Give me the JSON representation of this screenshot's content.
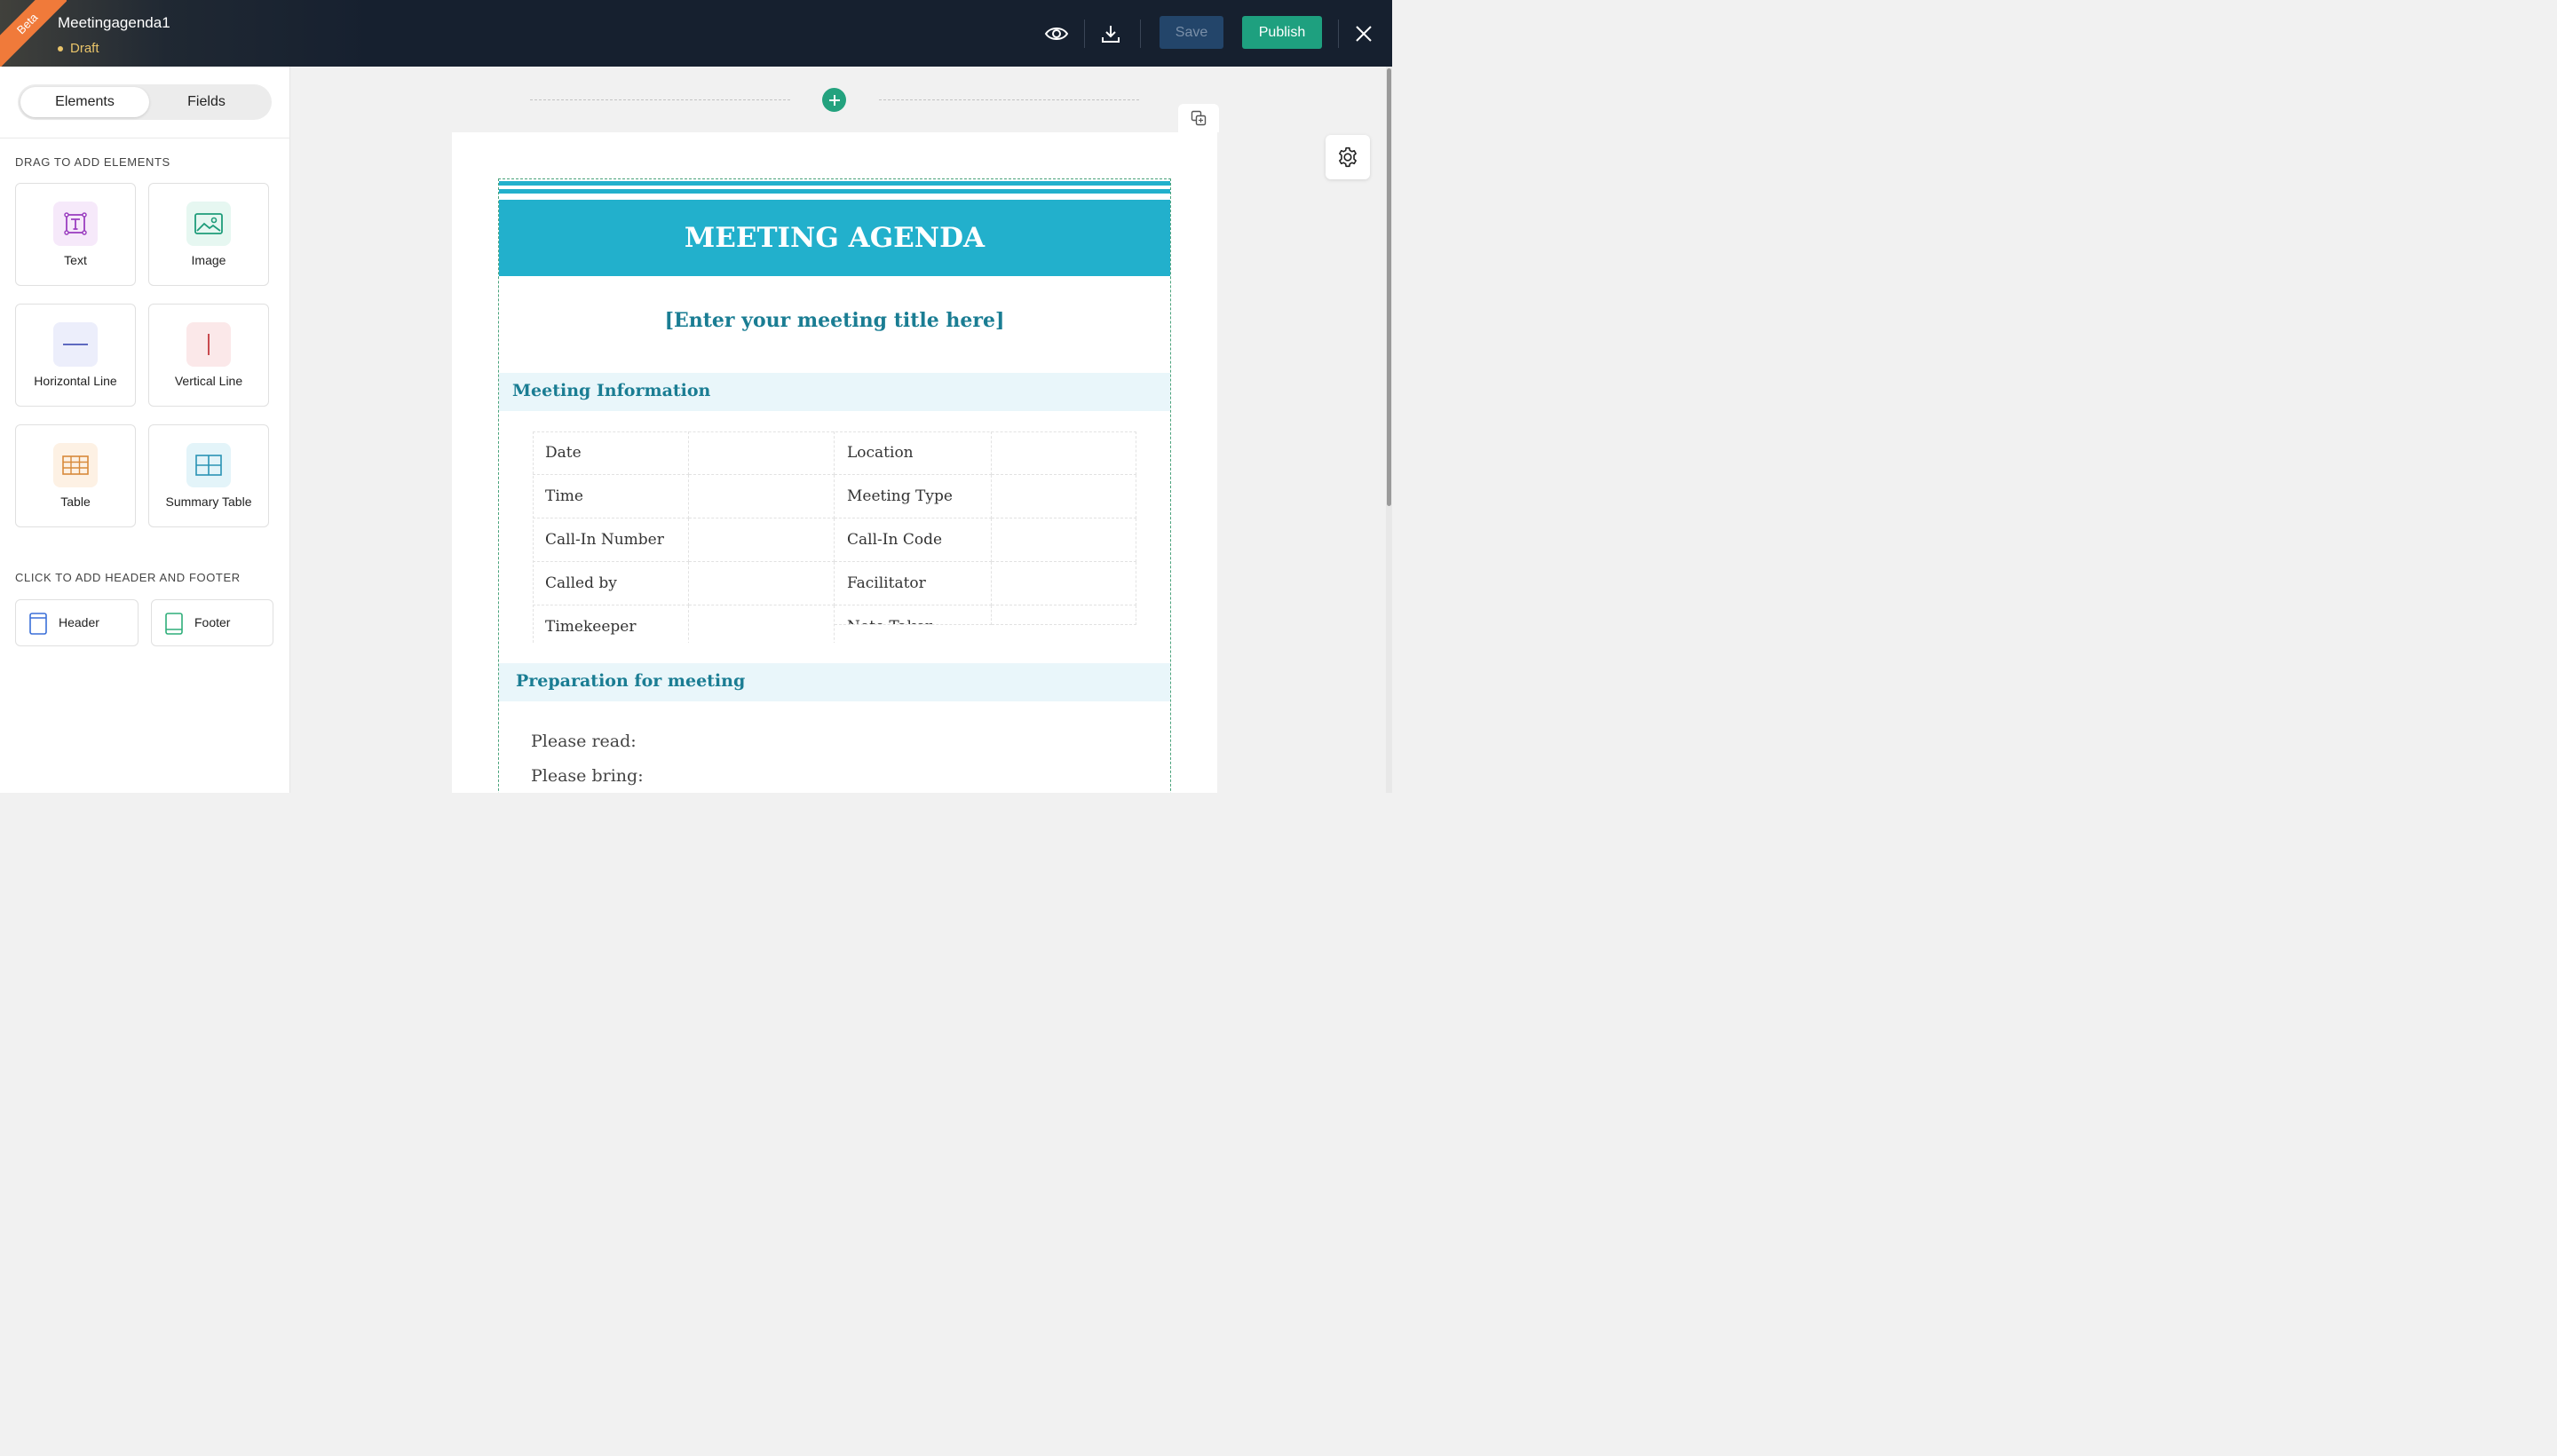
{
  "topbar": {
    "beta_label": "Beta",
    "document_name": "Meetingagenda1",
    "status": "Draft",
    "save_label": "Save",
    "publish_label": "Publish",
    "icons": [
      "eye-icon",
      "download-icon",
      "close-icon"
    ]
  },
  "sidebar": {
    "tabs": [
      {
        "label": "Elements",
        "active": true
      },
      {
        "label": "Fields",
        "active": false
      }
    ],
    "drag_heading": "DRAG TO ADD ELEMENTS",
    "elements": [
      {
        "label": "Text",
        "icon": "text-icon",
        "color": "#9b3fc0"
      },
      {
        "label": "Image",
        "icon": "image-icon",
        "color": "#1e9c7a"
      },
      {
        "label": "Horizontal Line",
        "icon": "horizontal-line-icon",
        "color": "#4a56b8"
      },
      {
        "label": "Vertical Line",
        "icon": "vertical-line-icon",
        "color": "#c4383e"
      },
      {
        "label": "Table",
        "icon": "table-icon",
        "color": "#d88a3a"
      },
      {
        "label": "Summary Table",
        "icon": "summary-table-icon",
        "color": "#2a93b4"
      }
    ],
    "header_footer_heading": "CLICK TO ADD HEADER AND FOOTER",
    "header_footer": [
      {
        "label": "Header",
        "icon": "header-icon",
        "color": "#3a6fd8"
      },
      {
        "label": "Footer",
        "icon": "footer-icon",
        "color": "#2fae7a"
      }
    ]
  },
  "document": {
    "banner_title": "MEETING AGENDA",
    "meeting_title_placeholder": "[Enter your meeting title here]",
    "section_info": "Meeting Information",
    "info_rows": [
      [
        "Date",
        "Location"
      ],
      [
        "Time",
        "Meeting Type"
      ],
      [
        "Call-In Number",
        "Call-In Code"
      ],
      [
        "Called by",
        "Facilitator"
      ],
      [
        "Timekeeper",
        "Note Taker"
      ]
    ],
    "section_prep": "Preparation for meeting",
    "prep_items": [
      "Please read:",
      "Please bring:"
    ],
    "accent_color": "#22b0cc",
    "heading_color": "#1a7d93"
  }
}
